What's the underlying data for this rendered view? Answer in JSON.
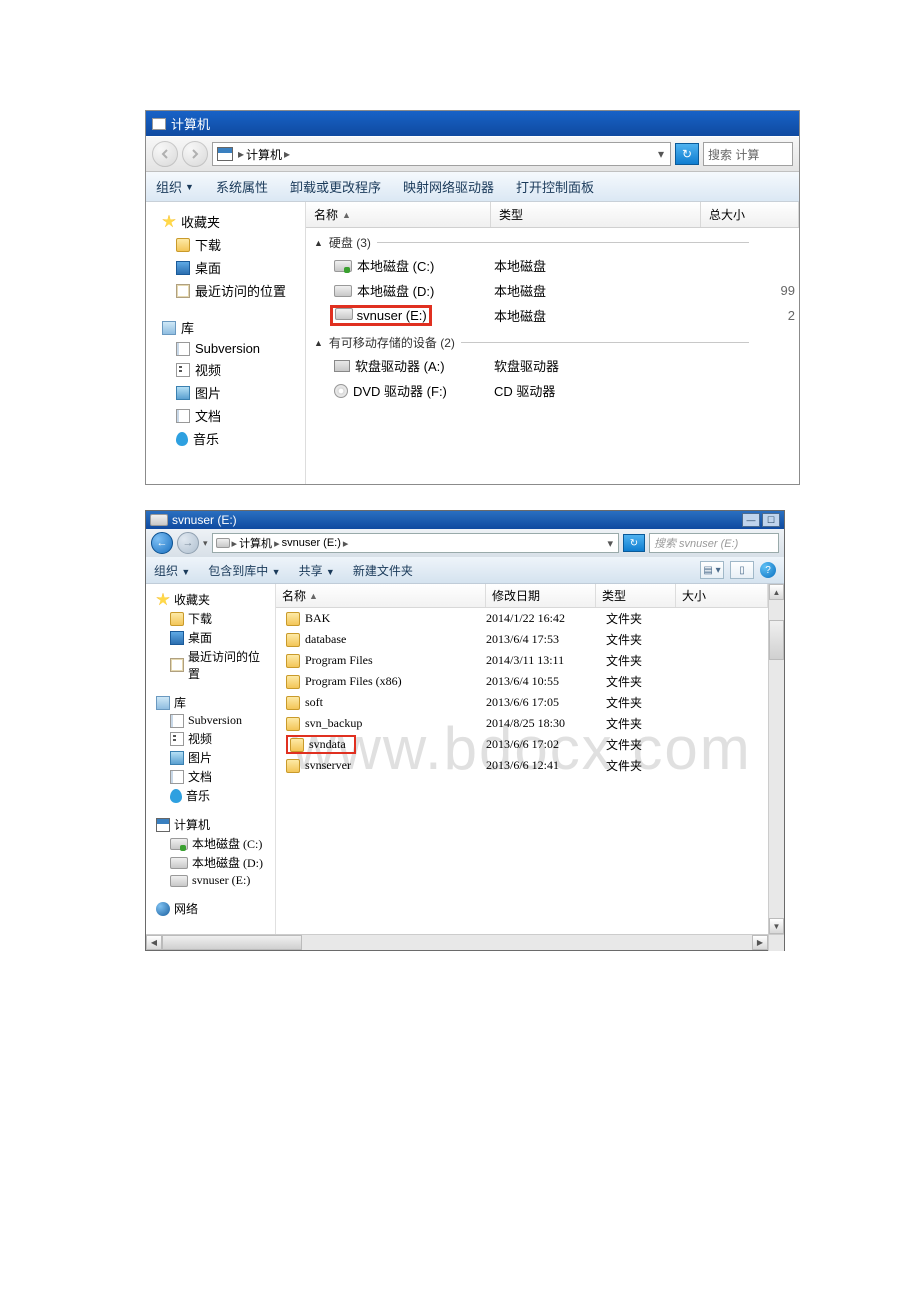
{
  "watermark": "www.bdocx.com",
  "win1": {
    "title": "计算机",
    "breadcrumb": [
      "计算机"
    ],
    "search_placeholder": "搜索 计算",
    "toolbar": {
      "org": "组织",
      "sysprop": "系统属性",
      "uninstall": "卸载或更改程序",
      "mapnet": "映射网络驱动器",
      "ctrlpanel": "打开控制面板"
    },
    "sidebar": {
      "fav": {
        "label": "收藏夹",
        "items": [
          "下载",
          "桌面",
          "最近访问的位置"
        ]
      },
      "lib": {
        "label": "库",
        "items": [
          "Subversion",
          "视频",
          "图片",
          "文档",
          "音乐"
        ]
      }
    },
    "columns": {
      "name": "名称",
      "type": "类型",
      "size": "总大小"
    },
    "groups": [
      {
        "label": "硬盘 (3)",
        "rows": [
          {
            "name": "本地磁盘 (C:)",
            "type": "本地磁盘",
            "icon": "drive-c"
          },
          {
            "name": "本地磁盘 (D:)",
            "type": "本地磁盘",
            "icon": "drive",
            "right": "99"
          },
          {
            "name": "svnuser (E:)",
            "type": "本地磁盘",
            "icon": "drive",
            "right": "2",
            "highlight": true
          }
        ]
      },
      {
        "label": "有可移动存储的设备 (2)",
        "rows": [
          {
            "name": "软盘驱动器 (A:)",
            "type": "软盘驱动器",
            "icon": "floppy"
          },
          {
            "name": "DVD 驱动器 (F:)",
            "type": "CD 驱动器",
            "icon": "cd"
          }
        ]
      }
    ]
  },
  "win2": {
    "title": "svnuser (E:)",
    "breadcrumb": [
      "计算机",
      "svnuser (E:)"
    ],
    "search_placeholder": "搜索 svnuser (E:)",
    "toolbar": {
      "org": "组织",
      "inclib": "包含到库中",
      "share": "共享",
      "newfolder": "新建文件夹"
    },
    "sidebar": {
      "fav": {
        "label": "收藏夹",
        "items": [
          "下载",
          "桌面",
          "最近访问的位置"
        ]
      },
      "lib": {
        "label": "库",
        "items": [
          "Subversion",
          "视频",
          "图片",
          "文档",
          "音乐"
        ]
      },
      "pc": {
        "label": "计算机",
        "items": [
          "本地磁盘 (C:)",
          "本地磁盘 (D:)",
          "svnuser (E:)"
        ]
      },
      "net": {
        "label": "网络"
      }
    },
    "columns": {
      "name": "名称",
      "date": "修改日期",
      "type": "类型",
      "size": "大小"
    },
    "rows": [
      {
        "name": "BAK",
        "date": "2014/1/22 16:42",
        "type": "文件夹"
      },
      {
        "name": "database",
        "date": "2013/6/4 17:53",
        "type": "文件夹"
      },
      {
        "name": "Program Files",
        "date": "2014/3/11 13:11",
        "type": "文件夹"
      },
      {
        "name": "Program Files (x86)",
        "date": "2013/6/4 10:55",
        "type": "文件夹"
      },
      {
        "name": "soft",
        "date": "2013/6/6 17:05",
        "type": "文件夹"
      },
      {
        "name": "svn_backup",
        "date": "2014/8/25 18:30",
        "type": "文件夹"
      },
      {
        "name": "svndata",
        "date": "2013/6/6 17:02",
        "type": "文件夹",
        "highlight": true
      },
      {
        "name": "svnserver",
        "date": "2013/6/6 12:41",
        "type": "文件夹"
      }
    ]
  }
}
